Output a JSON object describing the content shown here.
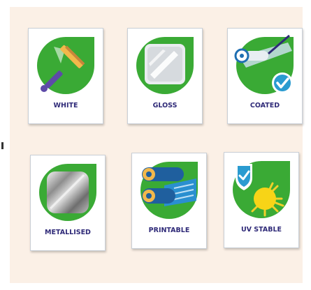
{
  "colors": {
    "background": "#fbf0e6",
    "green": "#3aaa35",
    "navy": "#2f2a78",
    "blue": "#1f6fb2",
    "teal": "#2a9bd0"
  },
  "cards": [
    {
      "label": "WHITE",
      "icon": "squeegee-icon"
    },
    {
      "label": "GLOSS",
      "icon": "glossy-sheet-icon"
    },
    {
      "label": "COATED",
      "icon": "coating-roller-icon"
    },
    {
      "label": "METALLISED",
      "icon": "metallic-cylinder-icon"
    },
    {
      "label": "PRINTABLE",
      "icon": "print-rollers-icon"
    },
    {
      "label": "UV STABLE",
      "icon": "sun-shield-icon"
    }
  ]
}
